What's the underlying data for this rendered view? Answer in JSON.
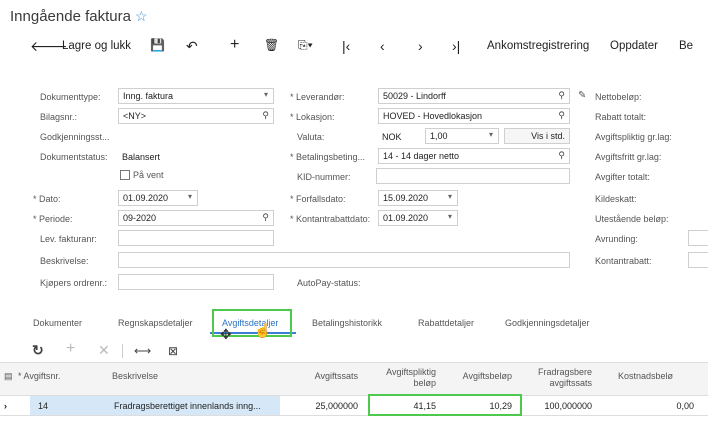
{
  "page": {
    "title": "Inngående faktura"
  },
  "toolbar": {
    "save_close": "Lagre og lukk",
    "receipt_registration": "Ankomstregistrering",
    "update": "Oppdater",
    "more": "Be"
  },
  "form": {
    "col1": {
      "doc_type_label": "Dokumenttype:",
      "doc_type_value": "Inng. faktura",
      "ref_label": "Bilagsnr.:",
      "ref_value": "<NY>",
      "approval_label": "Godkjenningsst...",
      "status_label": "Dokumentstatus:",
      "status_value": "Balansert",
      "on_hold_label": "På vent",
      "date_label": "Dato:",
      "date_value": "01.09.2020",
      "period_label": "Periode:",
      "period_value": "09-2020",
      "vendor_ref_label": "Lev. fakturanr:",
      "description_label": "Beskrivelse:",
      "buyer_order_label": "Kjøpers ordrenr.:"
    },
    "col2": {
      "vendor_label": "Leverandør:",
      "vendor_value": "50029 - Lindorff",
      "location_label": "Lokasjon:",
      "location_value": "HOVED - Hovedlokasjon",
      "currency_label": "Valuta:",
      "currency_value": "NOK",
      "rate_value": "1,00",
      "view_base": "Vis i std.",
      "terms_label": "Betalingsbeting...",
      "terms_value": "14 - 14 dager netto",
      "kid_label": "KID-nummer:",
      "due_label": "Forfallsdato:",
      "due_value": "15.09.2020",
      "cash_disc_label": "Kontantrabattdato:",
      "cash_disc_value": "01.09.2020",
      "autopay_label": "AutoPay-status:"
    },
    "col3": {
      "net_label": "Nettobeløp:",
      "discount_total_label": "Rabatt totalt:",
      "taxable_label": "Avgiftspliktig gr.lag:",
      "exempt_label": "Avgiftsfritt gr.lag:",
      "tax_total_label": "Avgifter totalt:",
      "withholding_label": "Kildeskatt:",
      "balance_label": "Utestående beløp:",
      "rounding_label": "Avrunding:",
      "cash_discount_label": "Kontantrabatt:"
    }
  },
  "tabs": [
    "Dokumenter",
    "Regnskapsdetaljer",
    "Avgiftsdetaljer",
    "Betalingshistorikk",
    "Rabattdetaljer",
    "Godkjenningsdetaljer"
  ],
  "grid": {
    "headers": {
      "tax_id": "Avgiftsnr.",
      "description": "Beskrivelse",
      "rate": "Avgiftssats",
      "taxable_1": "Avgiftspliktig",
      "taxable_2": "beløp",
      "tax_amount": "Avgiftsbeløp",
      "deductible_1": "Fradragsbere",
      "deductible_2": "avgiftssats",
      "expense": "Kostnadsbelø"
    },
    "row": {
      "tax_id": "14",
      "description": "Fradragsberettiget innenlands inng...",
      "rate": "25,000000",
      "taxable": "41,15",
      "tax_amount": "10,29",
      "deductible": "100,000000",
      "expense": "0,00"
    }
  },
  "colors": {
    "accent": "#3a7ed8",
    "highlight": "#4ec94e",
    "selected_row": "#d6e8f7"
  }
}
